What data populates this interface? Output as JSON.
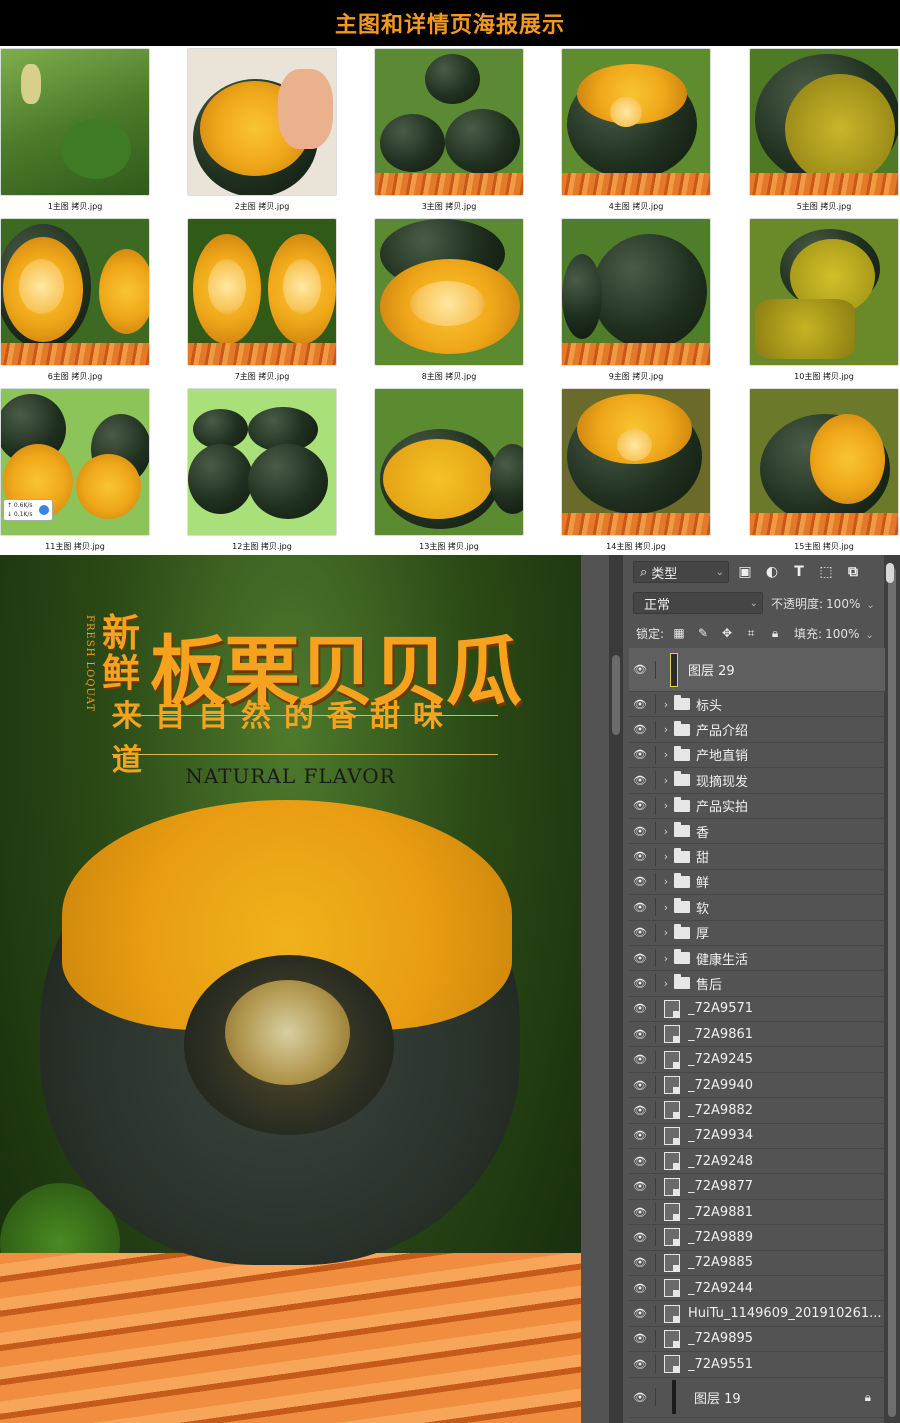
{
  "banner": {
    "title": "主图和详情页海报展示"
  },
  "thumbnails": [
    {
      "caption": "1主图 拷贝.jpg"
    },
    {
      "caption": "2主图 拷贝.jpg"
    },
    {
      "caption": "3主图 拷贝.jpg"
    },
    {
      "caption": "4主图 拷贝.jpg"
    },
    {
      "caption": "5主图 拷贝.jpg"
    },
    {
      "caption": "6主图 拷贝.jpg"
    },
    {
      "caption": "7主图 拷贝.jpg"
    },
    {
      "caption": "8主图 拷贝.jpg"
    },
    {
      "caption": "9主图 拷贝.jpg"
    },
    {
      "caption": "10主图 拷贝.jpg"
    },
    {
      "caption": "11主图 拷贝.jpg"
    },
    {
      "caption": "12主图 拷贝.jpg"
    },
    {
      "caption": "13主图 拷贝.jpg"
    },
    {
      "caption": "14主图 拷贝.jpg"
    },
    {
      "caption": "15主图 拷贝.jpg"
    }
  ],
  "speed_badge": {
    "up": "↑ 0.6K/s",
    "down": "↓ 0.1K/s"
  },
  "poster": {
    "fresh": "新鲜",
    "title": "板栗贝贝瓜",
    "vertical_en": "FRESH LOQUAT",
    "slogan": "来自自然的香甜味道",
    "en_subtitle": "NATURAL FLAVOR"
  },
  "panel": {
    "filter_label": "类型",
    "blend_mode": "正常",
    "opacity_label": "不透明度:",
    "opacity_value": "100%",
    "lock_label": "锁定:",
    "fill_label": "填充:",
    "fill_value": "100%",
    "top_layer": "图层 29",
    "groups": [
      "标头",
      "产品介绍",
      "产地直销",
      "现摘现发",
      "产品实拍",
      "香",
      "甜",
      "鲜",
      "软",
      "厚",
      "健康生活",
      "售后"
    ],
    "smart_layers": [
      "_72A9571",
      "_72A9861",
      "_72A9245",
      "_72A9940",
      "_72A9882",
      "_72A9934",
      "_72A9248",
      "_72A9877",
      "_72A9881",
      "_72A9889",
      "_72A9885",
      "_72A9244",
      "HuiTu_1149609_201910261...",
      "_72A9895",
      "_72A9551"
    ],
    "bottom_layer": "图层 19"
  }
}
